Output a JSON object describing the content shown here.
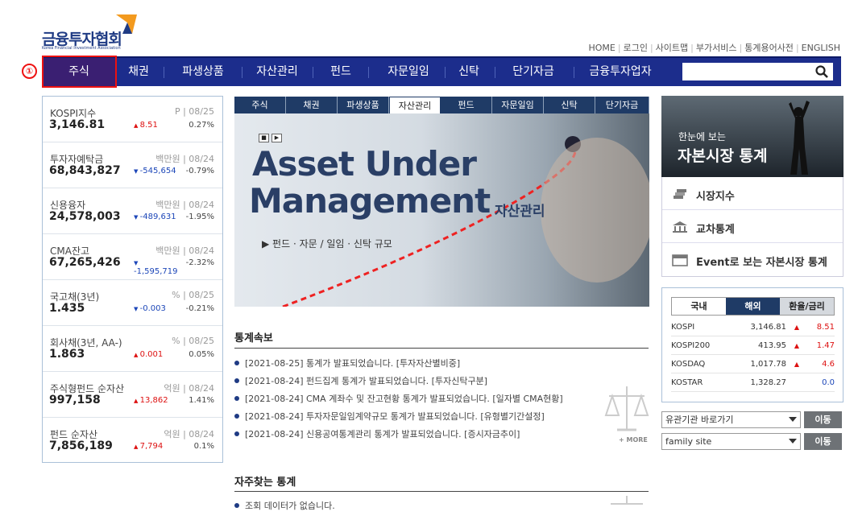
{
  "logo": {
    "title": "금융투자협회",
    "subtitle": "Korea Financial Investment Association"
  },
  "util": [
    "HOME",
    "로그인",
    "사이트맵",
    "부가서비스",
    "통계용어사전",
    "ENGLISH"
  ],
  "gnb": [
    "주식",
    "채권",
    "파생상품",
    "자산관리",
    "펀드",
    "자문일임",
    "신탁",
    "단기자금",
    "금융투자업자"
  ],
  "step_marker": "①",
  "search": {
    "placeholder": "",
    "value": ""
  },
  "stats": [
    {
      "name": "KOSPI지수",
      "unit": "P | 08/25",
      "value": "3,146.81",
      "dir": "up",
      "change": "8.51",
      "pct": "0.27%"
    },
    {
      "name": "투자자예탁금",
      "unit": "백만원 | 08/24",
      "value": "68,843,827",
      "dir": "down",
      "change": "-545,654",
      "pct": "-0.79%"
    },
    {
      "name": "신용융자",
      "unit": "백만원 | 08/24",
      "value": "24,578,003",
      "dir": "down",
      "change": "-489,631",
      "pct": "-1.95%"
    },
    {
      "name": "CMA잔고",
      "unit": "백만원 | 08/24",
      "value": "67,265,426",
      "dir": "down",
      "change": "-1,595,719",
      "pct": "-2.32%"
    },
    {
      "name": "국고채(3년)",
      "unit": "% | 08/25",
      "value": "1.435",
      "dir": "down",
      "change": "-0.003",
      "pct": "-0.21%"
    },
    {
      "name": "회사채(3년, AA-)",
      "unit": "% | 08/25",
      "value": "1.863",
      "dir": "up",
      "change": "0.001",
      "pct": "0.05%"
    },
    {
      "name": "주식형펀드 순자산",
      "unit": "억원 | 08/24",
      "value": "997,158",
      "dir": "up",
      "change": "13,862",
      "pct": "1.41%"
    },
    {
      "name": "펀드 순자산",
      "unit": "억원 | 08/24",
      "value": "7,856,189",
      "dir": "up",
      "change": "7,794",
      "pct": "0.1%"
    }
  ],
  "center_tabs": [
    "주식",
    "채권",
    "파생상품",
    "자산관리",
    "펀드",
    "자문일임",
    "신탁",
    "단기자금"
  ],
  "banner": {
    "line1": "Asset Under",
    "line2": "Management",
    "ko": "자산관리",
    "sub": "펀드 · 자문 / 일임 · 신탁 규모",
    "prev_label": "■",
    "play_label": "▶"
  },
  "news_title": "통계속보",
  "news": [
    "[2021-08-25] 통계가 발표되었습니다. [투자자산별비중]",
    "[2021-08-24] 펀드집계 통계가 발표되었습니다. [투자신탁구분]",
    "[2021-08-24] CMA 계좌수 및 잔고현황 통계가 발표되었습니다. [일자별 CMA현황]",
    "[2021-08-24] 투자자문일임계약규모 통계가 발표되었습니다. [유형별기간설정]",
    "[2021-08-24] 신용공여통계관리 통계가 발표되었습니다. [증시자금추이]"
  ],
  "more": "+ MORE",
  "faq_title": "자주찾는 통계",
  "faq_empty": "조회 데이터가 없습니다.",
  "rbanner": {
    "a": "한눈에 보는",
    "b": "자본시장 통계"
  },
  "rlinks": [
    "시장지수",
    "교차통계",
    "Event로 보는 자본시장 통계"
  ],
  "market_tabs": [
    "국내",
    "해외",
    "환율/금리"
  ],
  "market": [
    {
      "name": "KOSPI",
      "value": "3,146.81",
      "dir": "up",
      "change": "8.51"
    },
    {
      "name": "KOSPI200",
      "value": "413.95",
      "dir": "up",
      "change": "1.47"
    },
    {
      "name": "KOSDAQ",
      "value": "1,017.78",
      "dir": "up",
      "change": "4.6"
    },
    {
      "name": "KOSTAR",
      "value": "1,328.27",
      "dir": "",
      "change": "0.0"
    }
  ],
  "select1": "유관기관 바로가기",
  "select2": "family site",
  "go_label": "이동",
  "colors": {
    "nav": "#1c2d8c",
    "active_nav": "#3a1f72",
    "up": "#d11",
    "down": "#1c46b8",
    "highlight": "#e11"
  }
}
